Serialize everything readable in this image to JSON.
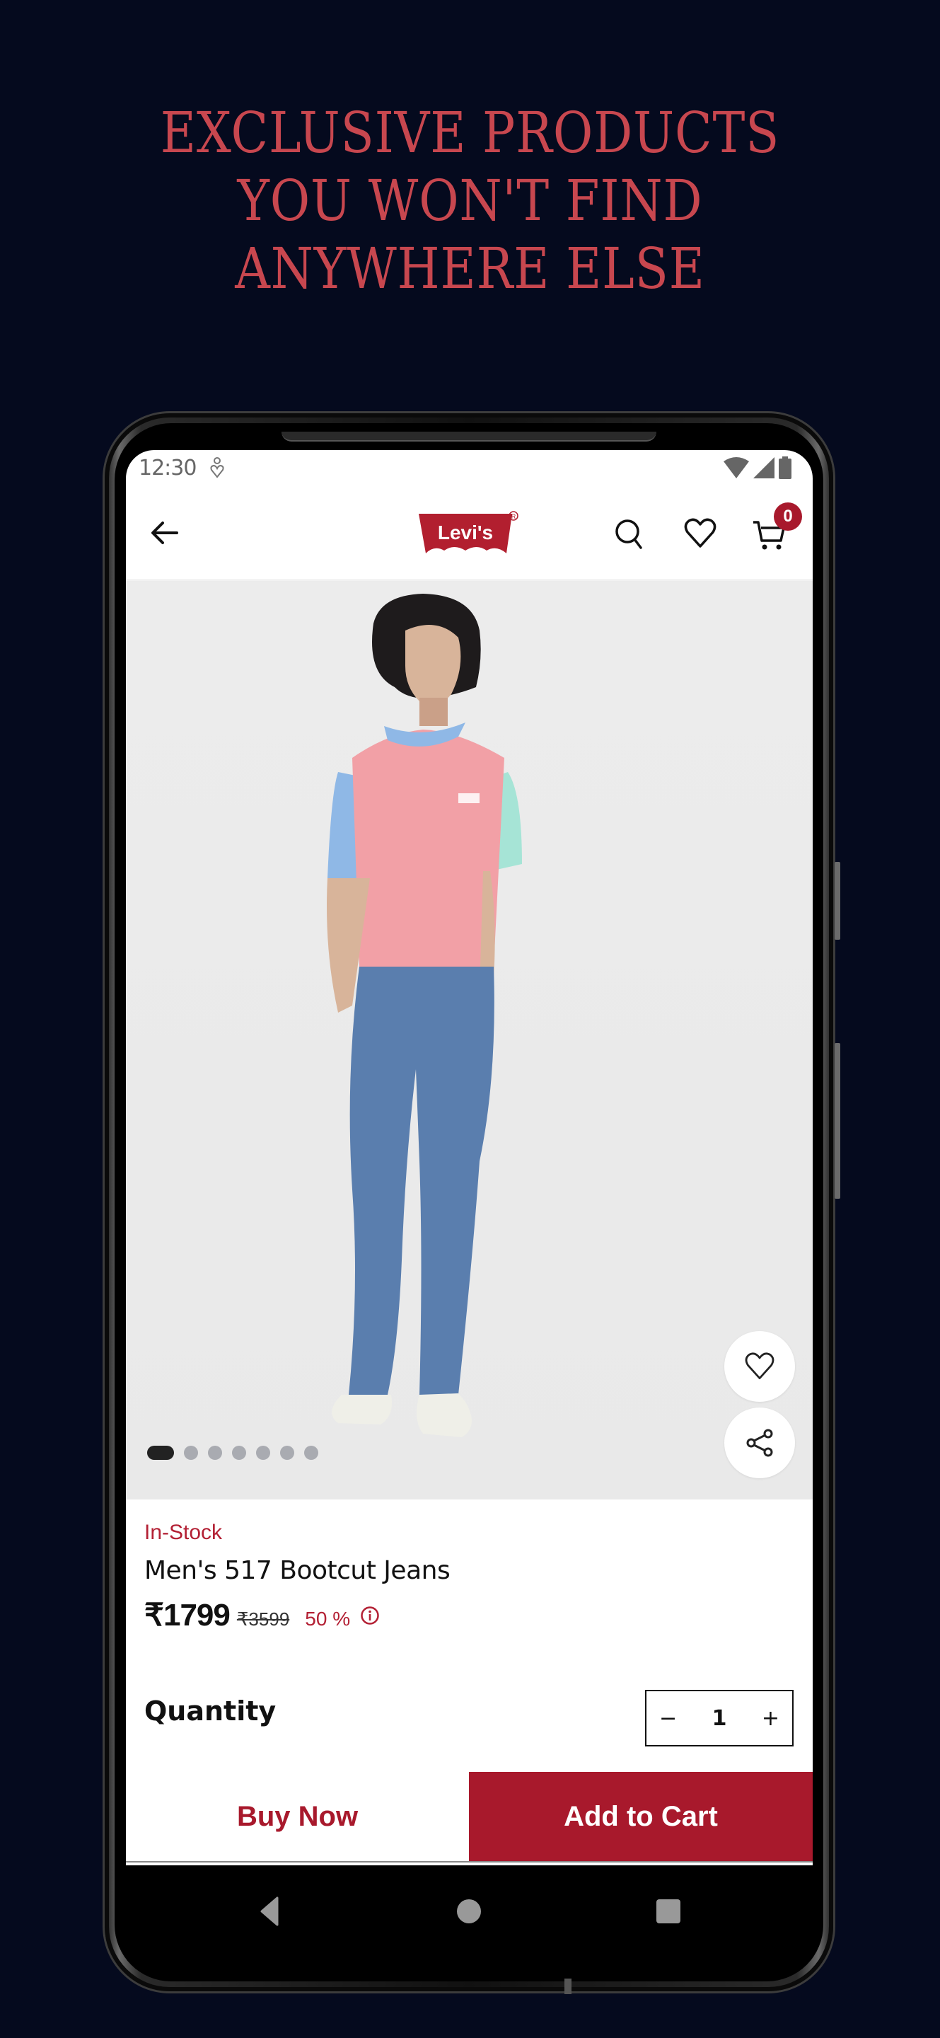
{
  "promo": {
    "headline_lines": [
      "EXCLUSIVE PRODUCTS",
      "YOU WON'T FIND",
      "ANYWHERE ELSE"
    ]
  },
  "status_bar": {
    "time": "12:30",
    "icons": [
      "accessibility-icon",
      "wifi-icon",
      "signal-icon",
      "battery-icon"
    ]
  },
  "app_bar": {
    "back_icon": "arrow-left-icon",
    "brand": "Levi's",
    "actions": [
      "search-icon",
      "heart-icon",
      "cart-icon"
    ],
    "cart_count": "0"
  },
  "gallery": {
    "image_description": "Model wearing a pink colour-block polo and blue bootcut jeans",
    "image_count": 7,
    "active_index": 0,
    "floating_actions": [
      "heart-icon",
      "share-icon"
    ]
  },
  "product": {
    "stock_status": "In-Stock",
    "name": "Men's 517 Bootcut Jeans",
    "price": "₹1799",
    "mrp": "₹3599",
    "discount": "50 %"
  },
  "quantity": {
    "label": "Quantity",
    "decrement": "−",
    "value": "1",
    "increment": "+"
  },
  "actions": {
    "buy_now": "Buy Now",
    "add_to_cart": "Add to Cart"
  },
  "colors": {
    "brand_red": "#a8192c",
    "headline_red": "#c8474f",
    "background": "#050a1e"
  }
}
